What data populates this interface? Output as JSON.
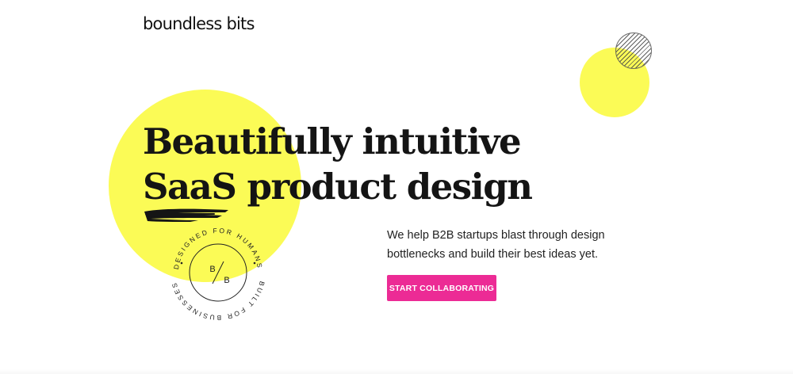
{
  "brand": {
    "logo_text": "boundless bits"
  },
  "hero": {
    "headline_line1": "Beautifully intuitive",
    "headline_line2": "SaaS product design",
    "description_line1": "We help B2B startups blast through design",
    "description_line2": "bottlenecks and build their best ideas yet.",
    "cta_label": "START COLLABORATING"
  },
  "badge": {
    "ring_text_top": "DESIGNED FOR HUMANS",
    "ring_text_bottom": "BUILT FOR BUSINESSES",
    "monogram_top": "B",
    "monogram_bottom": "B"
  },
  "colors": {
    "accent_yellow": "#fbfb56",
    "cta_pink": "#ec2b95",
    "text_dark": "#141414"
  },
  "icons": [
    "brush-stroke-icon",
    "hatched-circle-icon",
    "badge-seal-icon"
  ]
}
